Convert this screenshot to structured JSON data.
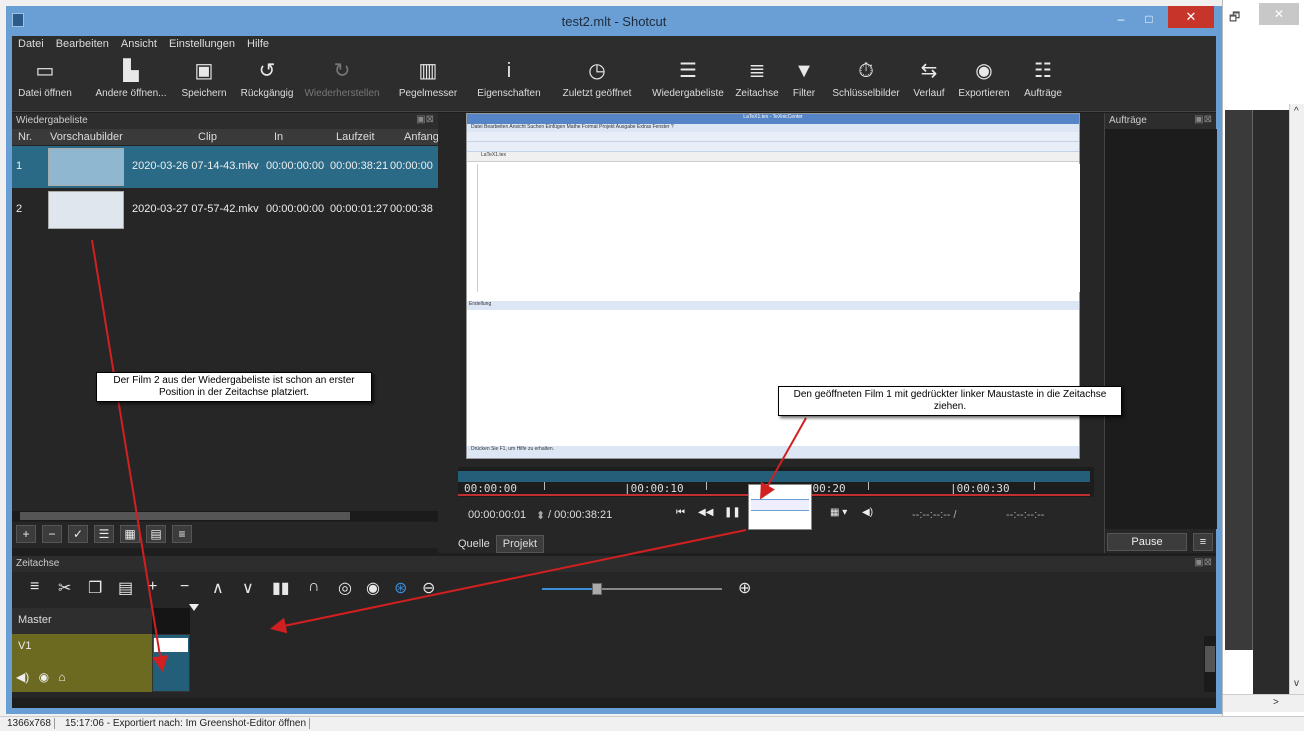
{
  "window": {
    "title": "test2.mlt - Shotcut",
    "minimize": "–",
    "maximize": "□",
    "close": "✕"
  },
  "background_window": {
    "restore": "🗗",
    "close": "✕",
    "scroll_left": "<",
    "scroll_right": ">",
    "scroll_up": "^",
    "scroll_down": "v"
  },
  "menu": [
    "Datei",
    "Bearbeiten",
    "Ansicht",
    "Einstellungen",
    "Hilfe"
  ],
  "toolbar": [
    {
      "label": "Datei öffnen",
      "icon": "folder-icon"
    },
    {
      "label": "Andere öffnen...",
      "icon": "open-other-icon"
    },
    {
      "label": "Speichern",
      "icon": "save-icon"
    },
    {
      "label": "Rückgängig",
      "icon": "undo-icon"
    },
    {
      "label": "Wiederherstellen",
      "icon": "redo-icon"
    },
    {
      "label": "Pegelmesser",
      "icon": "meter-icon"
    },
    {
      "label": "Eigenschaften",
      "icon": "info-icon"
    },
    {
      "label": "Zuletzt geöffnet",
      "icon": "clock-icon"
    },
    {
      "label": "Wiedergabeliste",
      "icon": "list-icon"
    },
    {
      "label": "Zeitachse",
      "icon": "timeline-icon"
    },
    {
      "label": "Filter",
      "icon": "filter-icon"
    },
    {
      "label": "Schlüsselbilder",
      "icon": "stopwatch-icon"
    },
    {
      "label": "Verlauf",
      "icon": "history-icon"
    },
    {
      "label": "Exportieren",
      "icon": "export-icon"
    },
    {
      "label": "Aufträge",
      "icon": "jobs-icon"
    }
  ],
  "playlist": {
    "title": "Wiedergabeliste",
    "columns": [
      "Nr.",
      "Vorschaubilder",
      "Clip",
      "In",
      "Laufzeit",
      "Anfang"
    ],
    "rows": [
      {
        "nr": "1",
        "clip": "2020-03-26 07-14-43.mkv",
        "in": "00:00:00:00",
        "duration": "00:00:38:21",
        "start": "00:00:00"
      },
      {
        "nr": "2",
        "clip": "2020-03-27 07-57-42.mkv",
        "in": "00:00:00:00",
        "duration": "00:00:01:27",
        "start": "00:00:38"
      }
    ]
  },
  "screen": {
    "title": "LaTeX1.tex - TeXnicCenter",
    "menu": "Datei Bearbeiten Ansicht Suchen Einfügen Mathe Format Projekt Ausgabe Extras Fenster ?",
    "tab": "LaTeX1.tex",
    "log_title": "Erstellung",
    "status": "Drücken Sie F1, um Hilfe zu erhalten."
  },
  "viewer": {
    "ruler_ticks": [
      "00:00:00",
      "|00:00:10",
      "|00:00:20",
      "|00:00:30"
    ],
    "position": "00:00:00:01",
    "duration": "/ 00:00:38:21",
    "in_point": "--:--:--:-- /",
    "out_point": "--:--:--:--",
    "tabs": [
      "Quelle",
      "Projekt"
    ]
  },
  "jobs": {
    "title": "Aufträge",
    "pause": "Pause"
  },
  "timeline": {
    "title": "Zeitachse",
    "master": "Master",
    "v1": "V1"
  },
  "annotations": {
    "callout_left": "Der Film 2 aus der Wiedergabeliste ist schon an erster Position in der Zeitachse platziert.",
    "callout_right": "Den geöffneten Film 1 mit gedrückter linker Maustaste in die Zeitachse ziehen."
  },
  "statusbar": {
    "resolution": "1366x768",
    "message": "15:17:06 - Exportiert nach: Im Greenshot-Editor öffnen"
  },
  "colors": {
    "titlebar": "#6a9fd6",
    "close": "#c7352a",
    "accent": "#245f7a",
    "annotation_arrow": "#d22020"
  }
}
